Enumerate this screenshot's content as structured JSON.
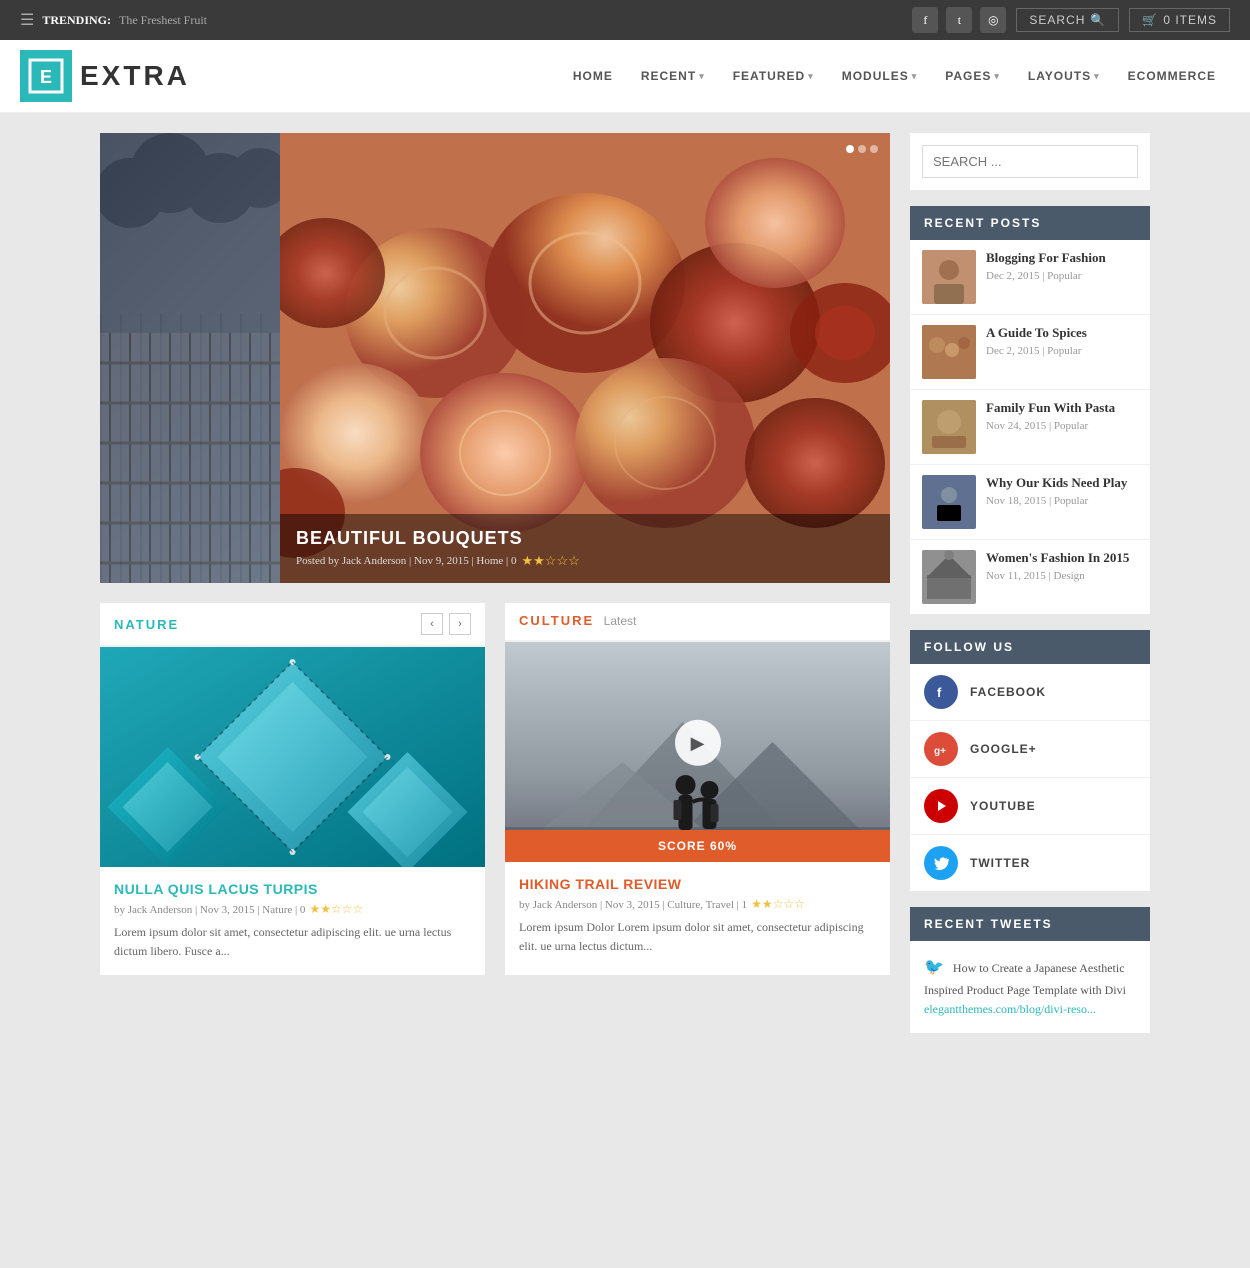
{
  "topbar": {
    "trending_label": "TRENDING:",
    "trending_text": "The Freshest Fruit",
    "search_label": "SEARCH",
    "cart_label": "0 ITEMS"
  },
  "header": {
    "logo_text": "EXTRA",
    "nav_items": [
      {
        "label": "HOME",
        "has_arrow": false
      },
      {
        "label": "RECENT",
        "has_arrow": true
      },
      {
        "label": "FEATURED",
        "has_arrow": true
      },
      {
        "label": "MODULES",
        "has_arrow": true
      },
      {
        "label": "PAGES",
        "has_arrow": true
      },
      {
        "label": "LAYOUTS",
        "has_arrow": true
      },
      {
        "label": "ECOMMERCE",
        "has_arrow": false
      }
    ]
  },
  "hero": {
    "title": "BEAUTIFUL BOUQUETS",
    "meta": "Posted by Jack Anderson | Nov 9, 2015 | Home | 0",
    "rating": "★★☆☆☆"
  },
  "nature_section": {
    "title": "NATURE",
    "card_title": "NULLA QUIS LACUS TURPIS",
    "card_meta": "by Jack Anderson | Nov 3, 2015 | Nature | 0",
    "card_text": "Lorem ipsum dolor sit amet, consectetur adipiscing elit. ue urna lectus dictum libero. Fusce a...",
    "card_stars": "★★☆☆☆"
  },
  "culture_section": {
    "title": "CULTURE",
    "subtitle": "Latest",
    "card_title": "HIKING TRAIL REVIEW",
    "card_meta": "by Jack Anderson | Nov 3, 2015 | Culture, Travel | 1",
    "card_text": "Lorem ipsum Dolor Lorem ipsum dolor sit amet, consectetur adipiscing elit. ue urna lectus dictum...",
    "card_stars": "★★☆☆☆",
    "score_label": "SCORE 60%"
  },
  "sidebar": {
    "search_placeholder": "SEARCH ...",
    "recent_posts_header": "RECENT POSTS",
    "recent_posts": [
      {
        "title": "Blogging For Fashion",
        "date": "Dec 2, 2015",
        "category": "Popular"
      },
      {
        "title": "A Guide To Spices",
        "date": "Dec 2, 2015",
        "category": "Popular"
      },
      {
        "title": "Family Fun With Pasta",
        "date": "Nov 24, 2015",
        "category": "Popular"
      },
      {
        "title": "Why Our Kids Need Play",
        "date": "Nov 18, 2015",
        "category": "Popular"
      },
      {
        "title": "Women's Fashion In 2015",
        "date": "Nov 11, 2015",
        "category": "Design"
      }
    ],
    "follow_header": "FOLLOW US",
    "follow_items": [
      {
        "label": "FACEBOOK",
        "icon": "f",
        "color": "fb-color"
      },
      {
        "label": "GOOGLE+",
        "icon": "g+",
        "color": "gplus-color"
      },
      {
        "label": "YOUTUBE",
        "icon": "▶",
        "color": "yt-color"
      },
      {
        "label": "TWITTER",
        "icon": "t",
        "color": "tw-color"
      }
    ],
    "tweets_header": "RECENT TWEETS",
    "tweet_text": "How to Create a Japanese Aesthetic Inspired Product Page Template with Divi",
    "tweet_link": "elegantthemes.com/blog/divi-reso..."
  }
}
